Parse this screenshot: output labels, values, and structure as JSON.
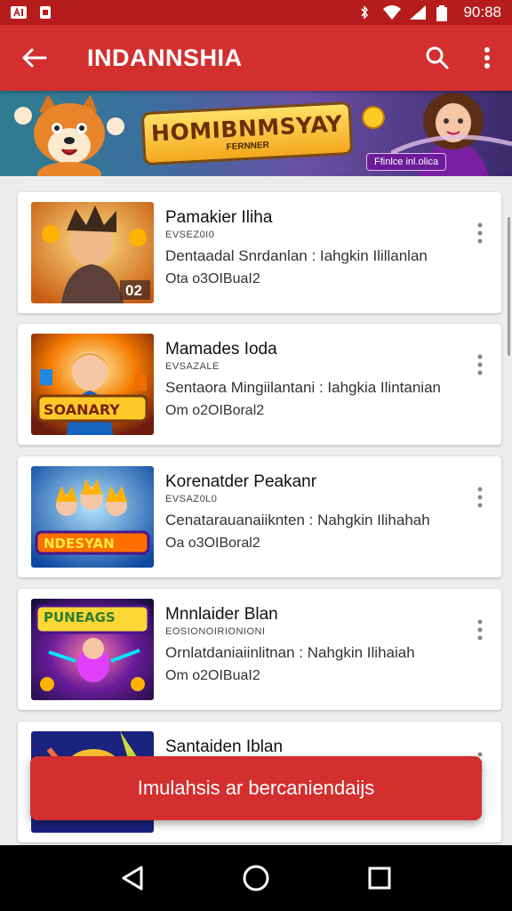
{
  "status_bar": {
    "time": "90:88"
  },
  "app_bar": {
    "title": "INDANNSHIA"
  },
  "banner": {
    "title": "HOMIBNMSYAY",
    "subtitle": "FERNNER",
    "tag": "Ffinlce inl.olica"
  },
  "cards": [
    {
      "title": "Pamakier Iliha",
      "subtitle": "EVSEZ0I0",
      "description": "Dentaadal Snrdanlan : Iahgkin Ilillanlan",
      "meta": "Ota o3OIBuaI2",
      "badge": "02"
    },
    {
      "title": "Mamades Ioda",
      "subtitle": "EVSAZALE",
      "description": "Sentaora Mingiilantani : Iahgkia Ilintanian",
      "meta": "Om o2OIBoral2",
      "badge": "SOANARY"
    },
    {
      "title": "Korenatder Peakanr",
      "subtitle": "EVSAZ0L0",
      "description": "Cenatarauanaiiknten : Nahgkin Ilihahah",
      "meta": "Oa o3OIBoral2",
      "badge": "NDESYAN"
    },
    {
      "title": "Mnnlaider Blan",
      "subtitle": "EOSIONOIRIONIONI",
      "description": "Ornlatdaniaiinlitnan : Nahgkin Ilihaiah",
      "meta": "Om o2OIBuaI2",
      "badge": "PUNEAGS"
    },
    {
      "title": "Santaiden Iblan"
    }
  ],
  "toast": {
    "text": "Imulahsis ar bercaniendaijs"
  },
  "colors": {
    "primary": "#d32f2f",
    "primary_dark": "#b71c1c"
  }
}
